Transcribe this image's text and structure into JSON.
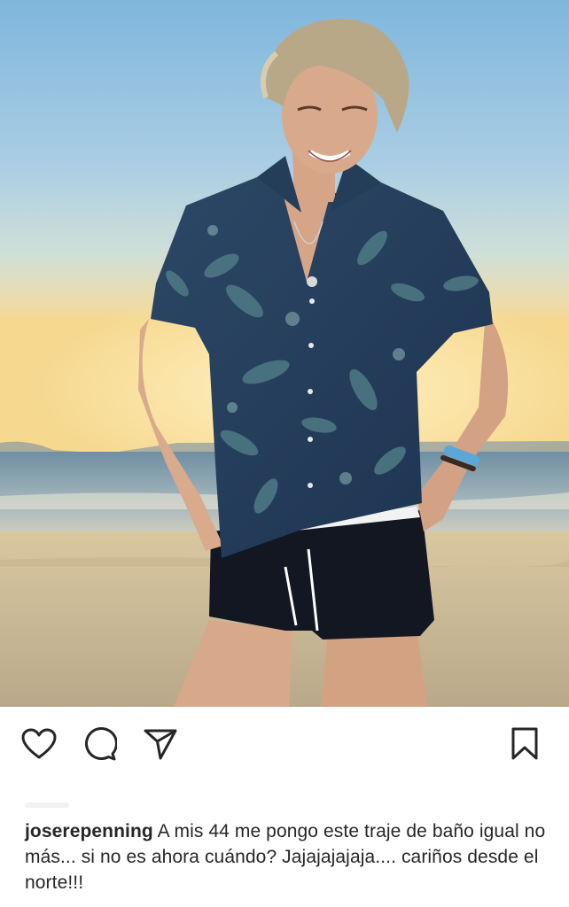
{
  "post": {
    "photo_icon": "beach-portrait-photo",
    "actions": {
      "like_icon": "heart-icon",
      "comment_icon": "comment-bubble-icon",
      "share_icon": "paper-plane-icon",
      "save_icon": "bookmark-icon"
    },
    "caption": {
      "username": "joserepenning",
      "text": "A mis 44 me pongo este traje de baño igual no más... si no es ahora cuándo? Jajajajajaja.... cariños desde el norte!!!"
    }
  },
  "colors": {
    "icon": "#262626",
    "text": "#262626",
    "background": "#ffffff"
  }
}
